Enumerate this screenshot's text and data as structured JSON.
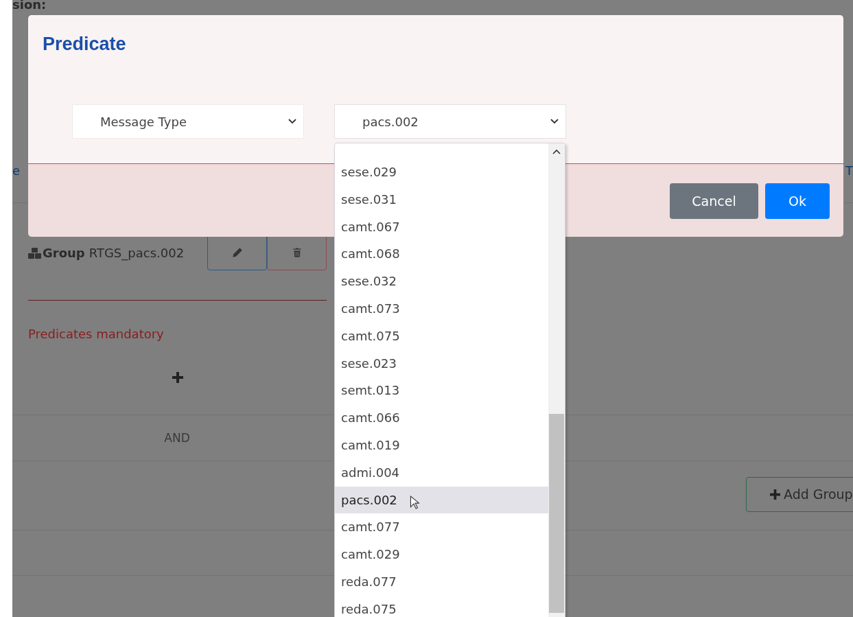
{
  "page": {
    "top_fragment": "sion:",
    "left_fragment": "e",
    "right_fragment": "T"
  },
  "group": {
    "label": "Group",
    "name": "RTGS_pacs.002"
  },
  "error": "Predicates mandatory",
  "operator": "AND",
  "add_group_button": "Add Group",
  "modal": {
    "title": "Predicate",
    "field_select": {
      "value": "Message Type"
    },
    "value_select": {
      "value": "pacs.002",
      "expanded": true
    },
    "options": [
      {
        "label": "sese.029",
        "selected": false
      },
      {
        "label": "sese.031",
        "selected": false
      },
      {
        "label": "camt.067",
        "selected": false
      },
      {
        "label": "camt.068",
        "selected": false
      },
      {
        "label": "sese.032",
        "selected": false
      },
      {
        "label": "camt.073",
        "selected": false
      },
      {
        "label": "camt.075",
        "selected": false
      },
      {
        "label": "sese.023",
        "selected": false
      },
      {
        "label": "semt.013",
        "selected": false
      },
      {
        "label": "camt.066",
        "selected": false
      },
      {
        "label": "camt.019",
        "selected": false
      },
      {
        "label": "admi.004",
        "selected": false
      },
      {
        "label": "pacs.002",
        "selected": true
      },
      {
        "label": "camt.077",
        "selected": false
      },
      {
        "label": "camt.029",
        "selected": false
      },
      {
        "label": "reda.077",
        "selected": false
      },
      {
        "label": "reda.075",
        "selected": false
      }
    ],
    "buttons": [
      {
        "label": "Cancel",
        "kind": "secondary"
      },
      {
        "label": "Ok",
        "kind": "primary"
      }
    ]
  }
}
